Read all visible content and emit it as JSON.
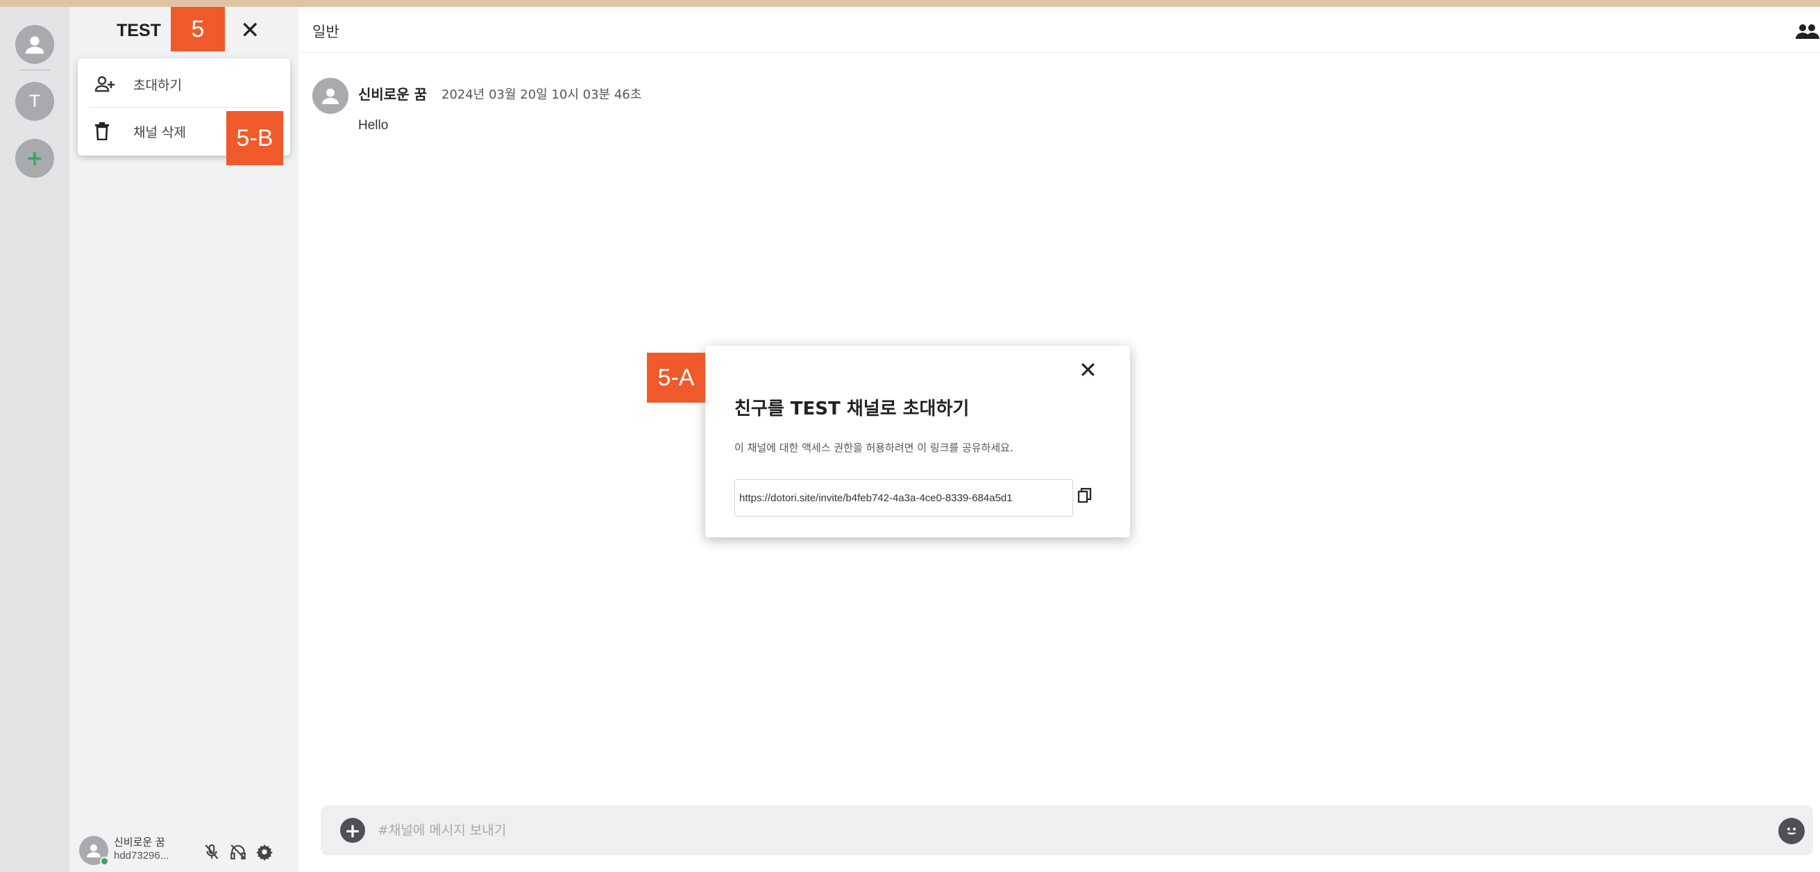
{
  "server": {
    "name": "TEST",
    "rail_letter": "T",
    "add_symbol": "+"
  },
  "menu": {
    "invite_label": "초대하기",
    "delete_label": "채널 삭제"
  },
  "main": {
    "channel_name": "일반"
  },
  "message": {
    "author": "신비로운 꿈",
    "timestamp": "2024년 03월 20일 10시 03분 46초",
    "text": "Hello"
  },
  "composer": {
    "placeholder": "#채널에 메시지 보내기"
  },
  "user": {
    "name": "신비로운 꿈",
    "id": "hdd73296..."
  },
  "modal": {
    "title": "친구를 TEST 채널로 초대하기",
    "description": "이 채널에 대한 액세스 권한을 허용하려면 이 링크를 공유하세요.",
    "invite_link": "https://dotori.site/invite/b4feb742-4a3a-4ce0-8339-684a5d1"
  },
  "annotations": {
    "tag_main": "5",
    "tag_a": "5-A",
    "tag_b": "5-B"
  },
  "colors": {
    "accent_tag": "#f05a2a",
    "online": "#3ba55d",
    "sidebar": "#f1f2f3",
    "rail": "#e3e4e6"
  },
  "icons": [
    "user-avatar-icon",
    "plus-icon",
    "invite-user-icon",
    "trash-icon",
    "close-icon",
    "members-icon",
    "copy-icon",
    "mic-muted-icon",
    "headphones-muted-icon",
    "gear-icon",
    "emoji-icon"
  ]
}
